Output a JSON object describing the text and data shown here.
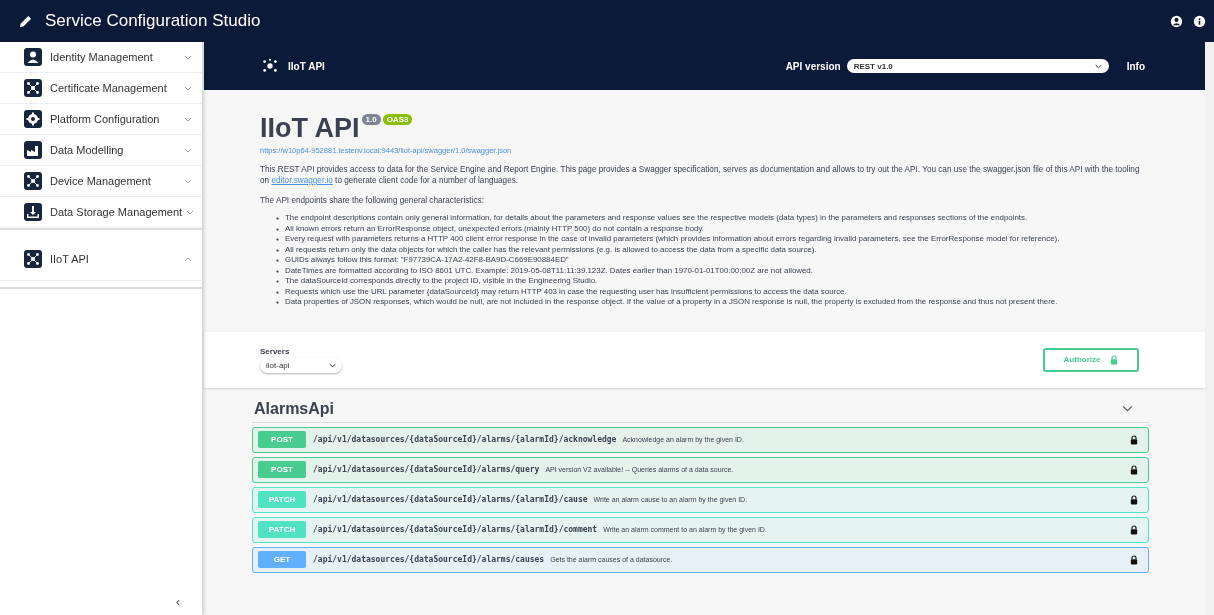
{
  "app": {
    "title": "Service Configuration Studio"
  },
  "sidebar": {
    "sections": [
      {
        "items": [
          {
            "label": "Identity Management",
            "expanded": false
          },
          {
            "label": "Certificate Management",
            "expanded": false
          },
          {
            "label": "Platform Configuration",
            "expanded": false
          },
          {
            "label": "Data Modelling",
            "expanded": false
          },
          {
            "label": "Device Management",
            "expanded": false
          },
          {
            "label": "Data Storage Management",
            "expanded": false
          }
        ]
      },
      {
        "items": [
          {
            "label": "IIoT API",
            "expanded": true
          }
        ]
      }
    ],
    "collapse": "‹"
  },
  "swagger_header": {
    "title": "IIoT API",
    "api_version_label": "API version",
    "api_version": "REST v1.0",
    "info": "Info"
  },
  "info": {
    "title": "IIoT API",
    "version": "1.0",
    "oas": "OAS3",
    "url": "https://w10p64-952881.testenv.local:9443/iiot-api/swagger/1.0/swagger.json",
    "intro_before": "This REST API provides access to data for the Service Engine and Report Engine. This page provides a Swagger specification, serves as documentation and allows to try out the API. You can use the swagger.json file of this API with the tooling on ",
    "intro_link": "editor.swagger.io",
    "intro_after": " to generate client code for a number of languages.",
    "characteristics_heading": "The API endpoints share the following general characteristics:",
    "characteristics": [
      "The endpoint descriptions contain only general information, for details about the parameters and response values see the respective models (data types) in the parameters and responses sections of the endpoints.",
      "All known errors return an ErrorResponse object, unexpected errors (mainly HTTP 500) do not contain a response body.",
      "Every request with parameters returns a HTTP 400 client error response in the case of invalid parameters (which provides information about errors regarding invalid parameters, see the ErrorResponse model for reference).",
      "All requests return only the data objects for which the caller has the relevant permissions (e.g. is allowed to access the data from a specific data source).",
      "GUIDs always follow this format: \"F97739CA-17A2-42F8-BA9D-C669E90884ED\"",
      "DateTimes are formatted according to ISO 8601 UTC. Example: 2019-05-08T11:11:39.123Z. Dates earlier than 1970-01-01T00:00:00Z are not allowed.",
      "The dataSourceId corresponds directly to the project ID, visible in the Engineering Studio.",
      "Requests which use the URL parameter {dataSourceId} may return HTTP 403 in case the requesting user has insufficient permissions to access the data source.",
      "Data properties of JSON responses, which would be null, are not included in the response object. If the value of a property in a JSON response is null, the property is excluded from the response and thus not present there."
    ]
  },
  "servers": {
    "label": "Servers",
    "value": "iiot-api",
    "authorize": "Authorize"
  },
  "tag": {
    "name": "AlarmsApi",
    "expanded": true,
    "operations": [
      {
        "method": "POST",
        "path": "/api/v1/datasources/{dataSourceId}/alarms/{alarmId}/acknowledge",
        "summary": "Acknowledge an alarm by the given ID."
      },
      {
        "method": "POST",
        "path": "/api/v1/datasources/{dataSourceId}/alarms/query",
        "summary": "API version V2 available! -- Queries alarms of a data source."
      },
      {
        "method": "PATCH",
        "path": "/api/v1/datasources/{dataSourceId}/alarms/{alarmId}/cause",
        "summary": "Write an alarm cause to an alarm by the given ID."
      },
      {
        "method": "PATCH",
        "path": "/api/v1/datasources/{dataSourceId}/alarms/{alarmId}/comment",
        "summary": "Write an alarm comment to an alarm by the given ID."
      },
      {
        "method": "GET",
        "path": "/api/v1/datasources/{dataSourceId}/alarms/causes",
        "summary": "Gets the alarm causes of a datasource."
      }
    ]
  }
}
